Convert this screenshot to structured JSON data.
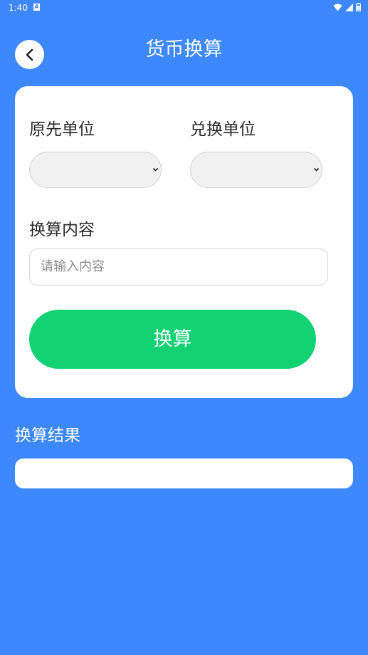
{
  "status_bar": {
    "time": "1:40",
    "notification_icon": "a-icon",
    "icons": [
      "wifi-icon",
      "signal-icon",
      "battery-icon"
    ]
  },
  "header": {
    "back_icon": "chevron-left-icon",
    "title": "货币换算"
  },
  "form": {
    "source_unit_label": "原先单位",
    "source_unit_value": "",
    "target_unit_label": "兑换单位",
    "target_unit_value": "",
    "amount_label": "换算内容",
    "amount_placeholder": "请输入内容",
    "amount_value": "",
    "convert_button_label": "换算"
  },
  "result": {
    "label": "换算结果",
    "value": ""
  },
  "colors": {
    "background": "#3d88fd",
    "card": "#ffffff",
    "button": "#12d173",
    "select_fill": "#f1f1f1"
  }
}
